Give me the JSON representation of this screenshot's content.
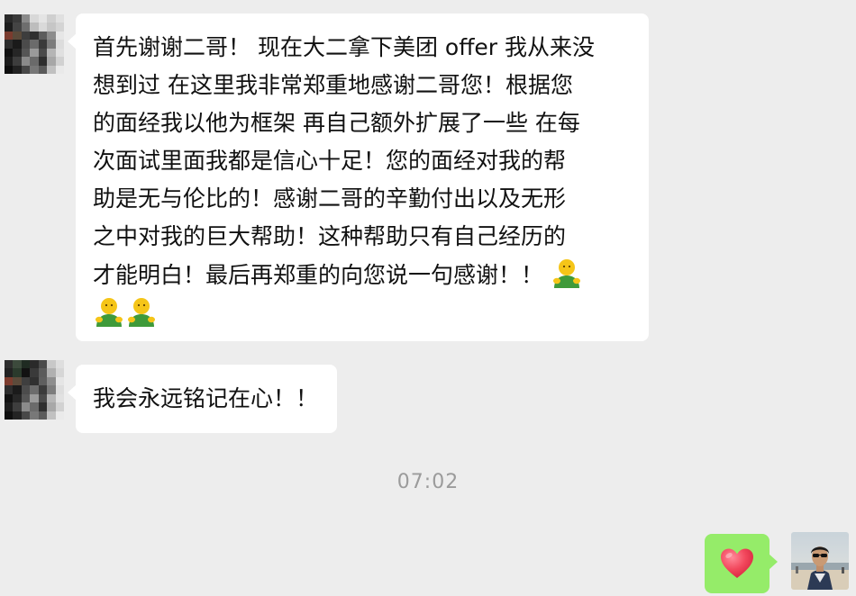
{
  "chat": {
    "messages": [
      {
        "sender": "contact",
        "avatar_icon": "pixelated-avatar-icon",
        "lines": [
          "首先谢谢二哥！ 现在大二拿下美团 offer 我从来没",
          "想到过 在这里我非常郑重地感谢二哥您！根据您",
          "的面经我以他为框架 再自己额外扩展了一些 在每",
          "次面试里面我都是信心十足！您的面经对我的帮",
          "助是无与伦比的！感谢二哥的辛勤付出以及无形",
          "之中对我的巨大帮助！这种帮助只有自己经历的",
          "才能明白！最后再郑重的向您说一句感谢！！"
        ],
        "emoji_icon": "hugging-person-emoji-icon"
      },
      {
        "sender": "contact",
        "avatar_icon": "pixelated-avatar-icon",
        "text": "我会永远铭记在心！！"
      }
    ],
    "timestamp": "07:02",
    "reply": {
      "sender": "me",
      "emoji_icon": "red-heart-emoji-icon",
      "bubble_color": "#95ec69",
      "avatar_icon": "profile-photo-icon"
    }
  },
  "colors": {
    "background": "#ededed",
    "bubble": "#ffffff",
    "text": "#111111",
    "timestamp": "#9b9b9b",
    "heart": "#f2475c"
  }
}
